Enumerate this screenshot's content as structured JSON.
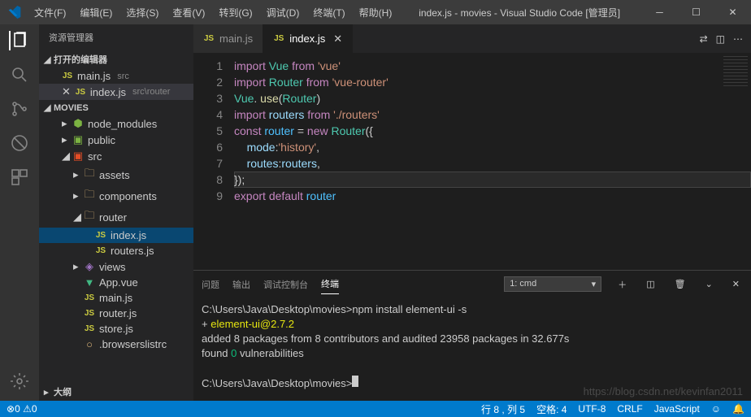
{
  "titlebar": {
    "menu": [
      "文件(F)",
      "编辑(E)",
      "选择(S)",
      "查看(V)",
      "转到(G)",
      "调试(D)",
      "终端(T)",
      "帮助(H)"
    ],
    "title": "index.js - movies - Visual Studio Code [管理员]"
  },
  "sidebar": {
    "header": "资源管理器",
    "openEditors": "打开的编辑器",
    "openItems": [
      {
        "icon": "js",
        "name": "main.js",
        "hint": "src"
      },
      {
        "icon": "js",
        "name": "index.js",
        "hint": "src\\router",
        "active": true,
        "close": true
      }
    ],
    "project": "MOVIES",
    "tree": [
      {
        "d": 1,
        "chev": "▸",
        "icon": "green",
        "iconGlyph": "⬢",
        "name": "node_modules"
      },
      {
        "d": 1,
        "chev": "▸",
        "icon": "green",
        "iconGlyph": "▣",
        "name": "public"
      },
      {
        "d": 1,
        "chev": "◢",
        "icon": "red",
        "iconGlyph": "▣",
        "name": "src"
      },
      {
        "d": 2,
        "chev": "▸",
        "icon": "fold",
        "iconGlyph": "🗀",
        "name": "assets"
      },
      {
        "d": 2,
        "chev": "▸",
        "icon": "fold",
        "iconGlyph": "🗀",
        "name": "components"
      },
      {
        "d": 2,
        "chev": "◢",
        "icon": "fold",
        "iconGlyph": "🗀",
        "name": "router"
      },
      {
        "d": 3,
        "icon": "js",
        "name": "index.js",
        "sel": true
      },
      {
        "d": 3,
        "icon": "js",
        "name": "routers.js"
      },
      {
        "d": 2,
        "chev": "▸",
        "icon": "purple",
        "iconGlyph": "◈",
        "name": "views"
      },
      {
        "d": 2,
        "icon": "vue",
        "iconGlyph": "▼",
        "name": "App.vue"
      },
      {
        "d": 2,
        "icon": "js",
        "name": "main.js"
      },
      {
        "d": 2,
        "icon": "js",
        "name": "router.js"
      },
      {
        "d": 2,
        "icon": "js",
        "name": "store.js"
      },
      {
        "d": 2,
        "icon": "fold",
        "iconGlyph": "○",
        "name": ".browserslistrc"
      }
    ],
    "outline": "大纲"
  },
  "tabs": [
    {
      "icon": "js",
      "name": "main.js",
      "active": false
    },
    {
      "icon": "js",
      "name": "index.js",
      "active": true
    }
  ],
  "code": {
    "lines": [
      [
        [
          "kw",
          "import"
        ],
        [
          "",
          " "
        ],
        [
          "cls",
          "Vue"
        ],
        [
          "",
          " "
        ],
        [
          "kw",
          "from"
        ],
        [
          "",
          " "
        ],
        [
          "str",
          "'vue'"
        ]
      ],
      [
        [
          "kw",
          "import"
        ],
        [
          "",
          " "
        ],
        [
          "cls",
          "Router"
        ],
        [
          "",
          " "
        ],
        [
          "kw",
          "from"
        ],
        [
          "",
          " "
        ],
        [
          "str",
          "'vue-router'"
        ]
      ],
      [
        [
          "cls",
          "Vue"
        ],
        [
          "",
          ". "
        ],
        [
          "fn",
          "use"
        ],
        [
          "",
          "("
        ],
        [
          "cls",
          "Router"
        ],
        [
          "",
          ")"
        ]
      ],
      [
        [
          "kw",
          "import"
        ],
        [
          "",
          " "
        ],
        [
          "var",
          "routers"
        ],
        [
          "",
          " "
        ],
        [
          "kw",
          "from"
        ],
        [
          "",
          " "
        ],
        [
          "str",
          "'./routers'"
        ]
      ],
      [
        [
          "kw",
          "const"
        ],
        [
          "",
          " "
        ],
        [
          "obj",
          "router"
        ],
        [
          "",
          " = "
        ],
        [
          "kw",
          "new"
        ],
        [
          "",
          " "
        ],
        [
          "cls",
          "Router"
        ],
        [
          "",
          "({"
        ]
      ],
      [
        [
          "",
          "    "
        ],
        [
          "var",
          "mode"
        ],
        [
          "",
          ":"
        ],
        [
          "str",
          "'history'"
        ],
        [
          "",
          ","
        ]
      ],
      [
        [
          "",
          "    "
        ],
        [
          "var",
          "routes"
        ],
        [
          "",
          ":"
        ],
        [
          "var",
          "routers"
        ],
        [
          "",
          ","
        ]
      ],
      [
        [
          "",
          "});"
        ]
      ],
      [
        [
          "kw",
          "export"
        ],
        [
          "",
          " "
        ],
        [
          "kw",
          "default"
        ],
        [
          "",
          " "
        ],
        [
          "obj",
          "router"
        ]
      ]
    ],
    "cursorLine": 8
  },
  "panel": {
    "tabs": [
      "问题",
      "输出",
      "调试控制台",
      "终端"
    ],
    "activeTab": "终端",
    "termSelector": "1: cmd",
    "lines": [
      "C:\\Users\\Java\\Desktop\\movies>npm install element-ui -s",
      "+ element-ui@2.7.2",
      "added 8 packages from 8 contributors and audited 23958 packages in 32.677s",
      "found 0 vulnerabilities",
      "",
      "C:\\Users\\Java\\Desktop\\movies>"
    ]
  },
  "status": {
    "errors": "0",
    "warnings": "0",
    "lineCol": "行 8 , 列 5",
    "spaces": "空格: 4",
    "encoding": "UTF-8",
    "eol": "CRLF",
    "lang": "JavaScript",
    "smile": "☺"
  },
  "watermark": "https://blog.csdn.net/kevinfan2011"
}
